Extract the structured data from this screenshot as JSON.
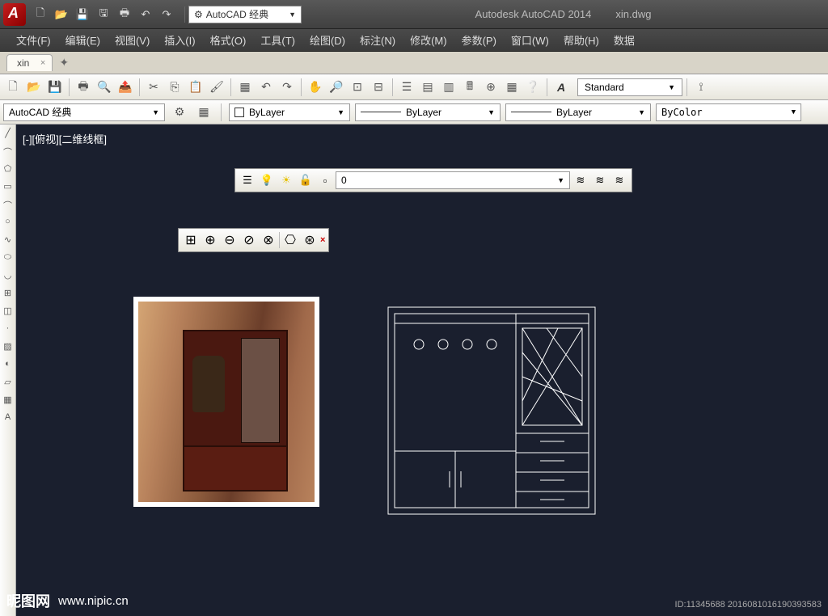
{
  "app": {
    "title": "Autodesk AutoCAD 2014",
    "filename": "xin.dwg"
  },
  "workspace_dropdown": "AutoCAD 经典",
  "menubar": [
    "文件(F)",
    "编辑(E)",
    "视图(V)",
    "插入(I)",
    "格式(O)",
    "工具(T)",
    "绘图(D)",
    "标注(N)",
    "修改(M)",
    "参数(P)",
    "窗口(W)",
    "帮助(H)",
    "数据"
  ],
  "tabs": {
    "active": "xin"
  },
  "text_style": "Standard",
  "workspace_combo2": "AutoCAD 经典",
  "layers": {
    "current_layer": "0",
    "combo_text": "ByLayer",
    "linetype": "ByLayer",
    "lineweight": "ByLayer",
    "bycolor": "ByColor"
  },
  "viewport_label": "[-][俯视][二维线框]",
  "float_layer_value": "0",
  "watermark": {
    "brand": "昵图网",
    "url": "www.nipic.cn"
  },
  "meta": "ID:11345688 2016081016190393583"
}
